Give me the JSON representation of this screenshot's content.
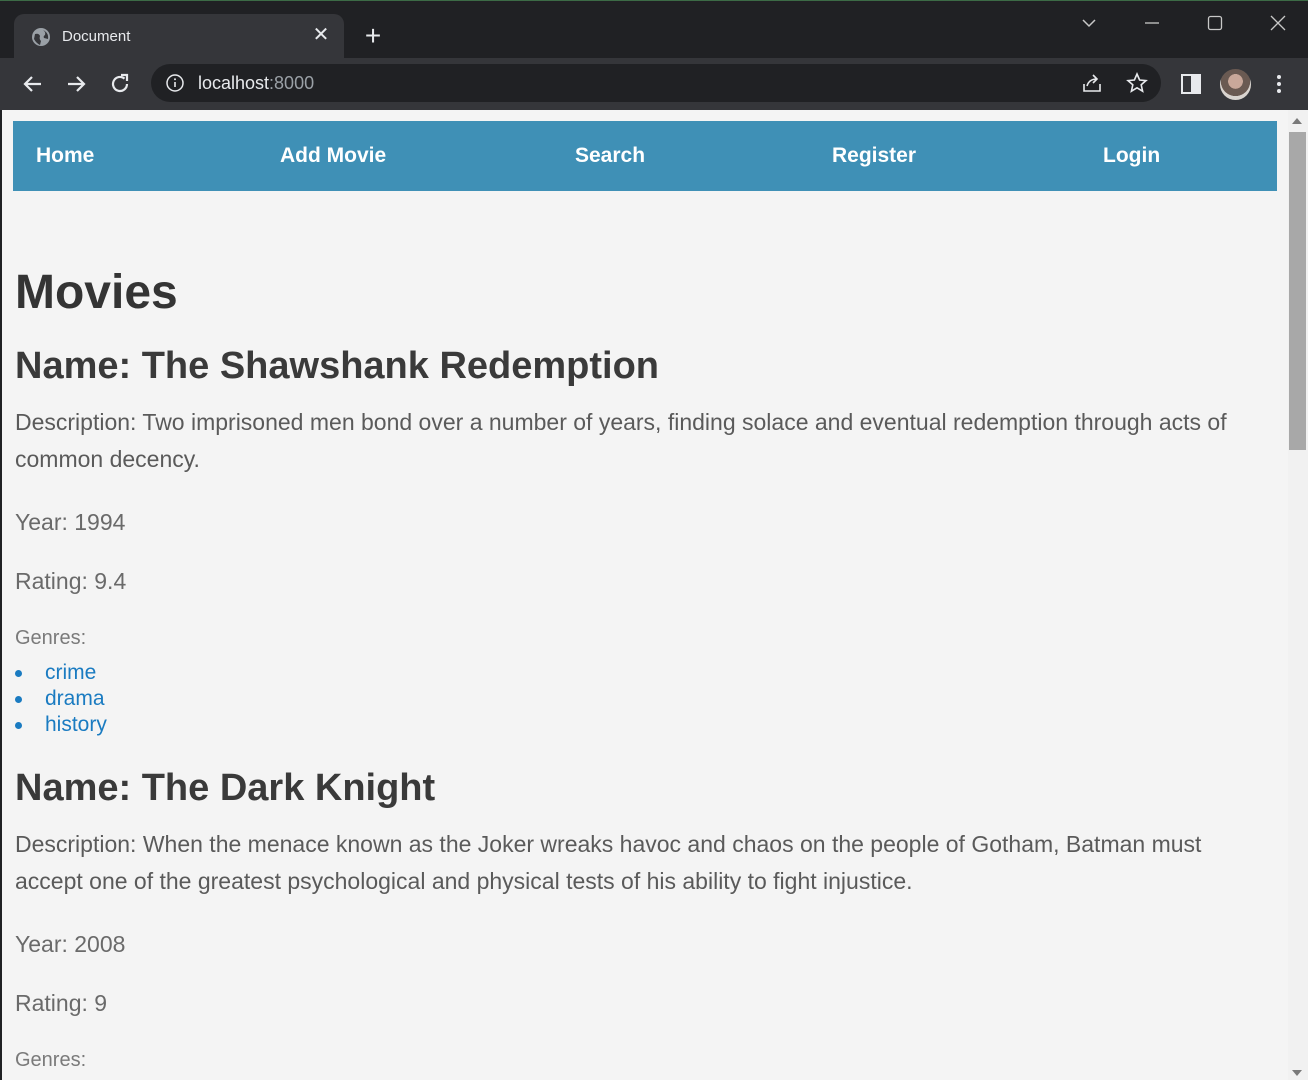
{
  "browser": {
    "tab_title": "Document",
    "url_host": "localhost",
    "url_port": ":8000"
  },
  "nav": {
    "items": [
      "Home",
      "Add Movie",
      "Search",
      "Register",
      "Login"
    ]
  },
  "page_title": "Movies",
  "movies": [
    {
      "name": "Name: The Shawshank Redemption",
      "description": "Description: Two imprisoned men bond over a number of years, finding solace and eventual redemption through acts of common decency.",
      "year": "Year: 1994",
      "rating": "Rating: 9.4",
      "genres_label": "Genres:",
      "genres": [
        "crime",
        "drama",
        "history"
      ]
    },
    {
      "name": "Name: The Dark Knight",
      "description": "Description: When the menace known as the Joker wreaks havoc and chaos on the people of Gotham, Batman must accept one of the greatest psychological and physical tests of his ability to fight injustice.",
      "year": "Year: 2008",
      "rating": "Rating: 9",
      "genres_label": "Genres:",
      "genres": []
    }
  ],
  "colors": {
    "navbar": "#3f90b6",
    "link": "#1a7bc1",
    "page_bg": "#f4f4f4"
  }
}
